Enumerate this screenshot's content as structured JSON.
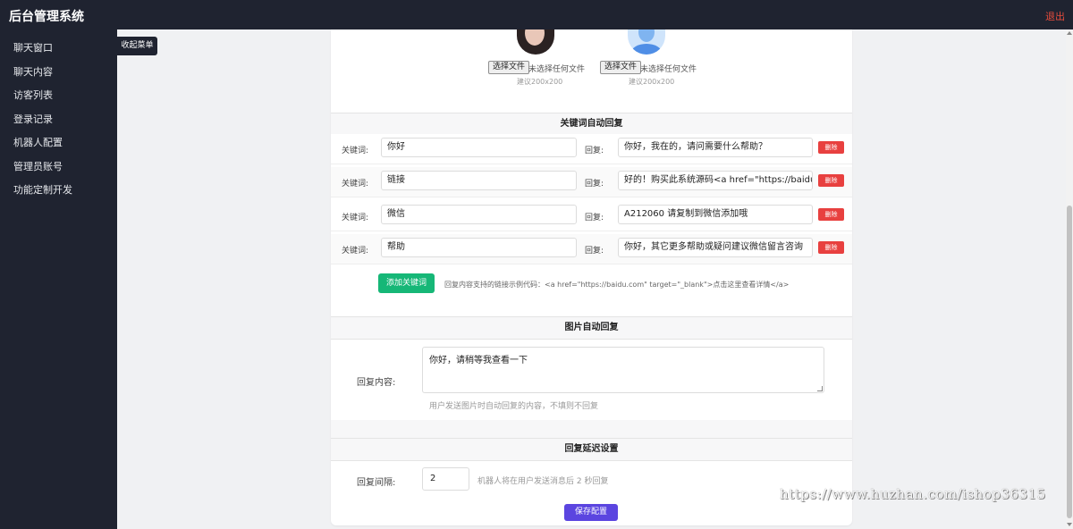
{
  "app": {
    "title": "后台管理系统",
    "logout_label": "退出"
  },
  "sidebar": {
    "items": [
      {
        "label": "聊天窗口"
      },
      {
        "label": "聊天内容"
      },
      {
        "label": "访客列表"
      },
      {
        "label": "登录记录"
      },
      {
        "label": "机器人配置"
      },
      {
        "label": "管理员账号"
      },
      {
        "label": "功能定制开发"
      }
    ],
    "collapse_tooltip": "收起菜单"
  },
  "avatars": [
    {
      "button_label": "选择文件",
      "status": "未选择任何文件",
      "hint": "建议200x200"
    },
    {
      "button_label": "选择文件",
      "status": "未选择任何文件",
      "hint": "建议200x200"
    }
  ],
  "keyword_section": {
    "title": "关键词自动回复",
    "keyword_label": "关键词:",
    "reply_label": "回复:",
    "delete_label": "删除",
    "rows": [
      {
        "keyword": "你好",
        "reply": "你好，我在的，请问需要什么帮助？"
      },
      {
        "keyword": "链接",
        "reply": "好的！购买此系统源码<a href=\"https://baidu.com"
      },
      {
        "keyword": "微信",
        "reply": "A212060 请复制到微信添加哦"
      },
      {
        "keyword": "帮助",
        "reply": "你好，其它更多帮助或疑问建议微信留言咨询"
      }
    ],
    "add_label": "添加关键词",
    "add_hint": "回复内容支持的链接示例代码：<a href=\"https://baidu.com\" target=\"_blank\">点击这里查看详情</a>"
  },
  "image_section": {
    "title": "图片自动回复",
    "label": "回复内容:",
    "value": "你好，请稍等我查看一下",
    "hint": "用户发送图片时自动回复的内容，不填则不回复"
  },
  "delay_section": {
    "title": "回复延迟设置",
    "label": "回复间隔:",
    "value": "2",
    "hint": "机器人将在用户发送消息后 2 秒回复"
  },
  "save_label": "保存配置",
  "watermark": "https://www.huzhan.com/ishop36315",
  "colors": {
    "sidebar_bg": "#1f2330",
    "add_green": "#16b777",
    "delete_red": "#e8403f",
    "save_purple": "#5b45e0",
    "logout_red": "#e74c3c"
  }
}
